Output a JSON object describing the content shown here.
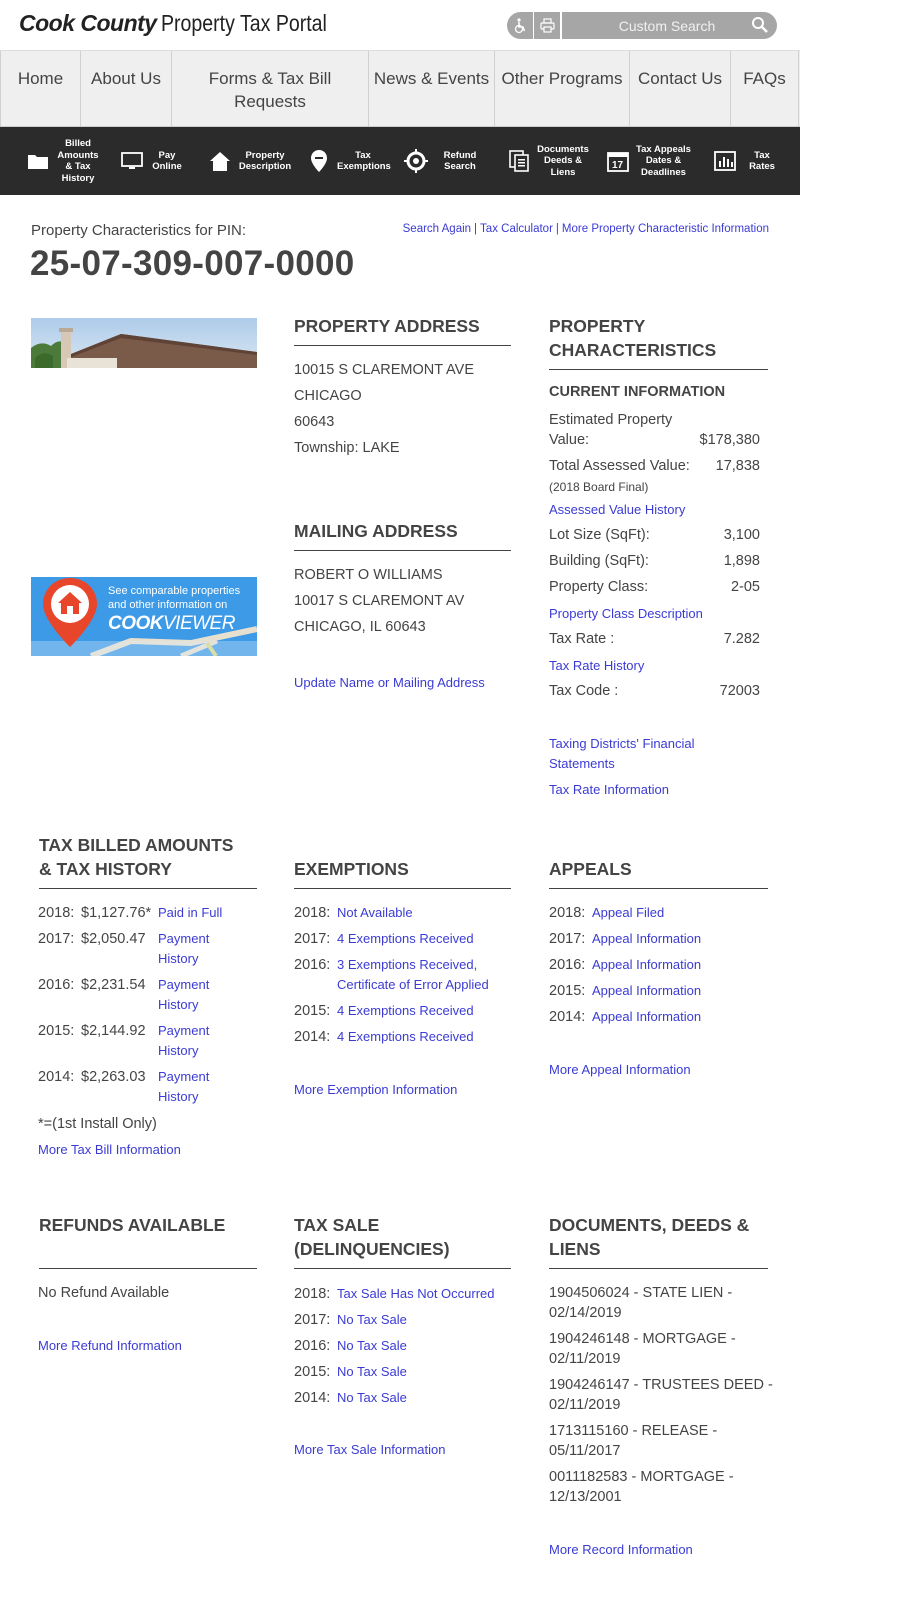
{
  "header": {
    "logo_bold": "Cook County",
    "logo_light": "Property Tax Portal",
    "search_placeholder": "Custom Search"
  },
  "main_nav": [
    "Home",
    "About Us",
    "Forms & Tax Bill Requests",
    "News & Events",
    "Other Programs",
    "Contact Us",
    "FAQs"
  ],
  "icon_bar": [
    {
      "icon": "folder-icon",
      "label": "Billed Amounts & Tax History"
    },
    {
      "icon": "monitor-icon",
      "label": "Pay Online"
    },
    {
      "icon": "house-icon",
      "label": "Property Description"
    },
    {
      "icon": "map-pin-icon",
      "label": "Tax Exemptions"
    },
    {
      "icon": "crosshair-icon",
      "label": "Refund Search"
    },
    {
      "icon": "documents-icon",
      "label": "Documents Deeds & Liens"
    },
    {
      "icon": "calendar-icon",
      "label": "Tax Appeals Dates & Deadlines"
    },
    {
      "icon": "bar-chart-icon",
      "label": "Tax Rates"
    }
  ],
  "pin": {
    "label": "Property Characteristics for PIN:",
    "number": "25-07-309-007-0000",
    "links": [
      "Search Again",
      "Tax Calculator",
      "More Property Characteristic Information"
    ]
  },
  "cookviewer": {
    "text_line1": "See comparable properties",
    "text_line2": "and other information on",
    "logo_a": "COOK",
    "logo_b": "VIEWER"
  },
  "property_address": {
    "title": "PROPERTY ADDRESS",
    "street": "10015 S CLAREMONT AVE",
    "city": "CHICAGO",
    "zip": "60643",
    "township": "Township: LAKE"
  },
  "mailing_address": {
    "title": "MAILING ADDRESS",
    "name": "ROBERT O WILLIAMS",
    "street": "10017 S CLAREMONT AV",
    "city": "CHICAGO, IL 60643",
    "update_link": "Update Name or Mailing Address"
  },
  "characteristics": {
    "title_line1": "PROPERTY",
    "title_line2": "CHARACTERISTICS",
    "current": "CURRENT INFORMATION",
    "est_label_1": "Estimated Property",
    "est_label_2": "Value:",
    "est_value": "$178,380",
    "tav_label": "Total Assessed Value:",
    "tav_value": "17,838",
    "tav_note": "(2018 Board Final)",
    "av_history": "Assessed Value History",
    "lot_label": "Lot Size (SqFt):",
    "lot_value": "3,100",
    "bldg_label": "Building (SqFt):",
    "bldg_value": "1,898",
    "class_label": "Property Class:",
    "class_value": "2-05",
    "class_link": "Property Class Description",
    "rate_label": "Tax Rate :",
    "rate_value": "7.282",
    "rate_link": "Tax Rate History",
    "code_label": "Tax Code :",
    "code_value": "72003",
    "districts_link_1": "Taxing Districts' Financial",
    "districts_link_2": "Statements",
    "rate_info_link": "Tax Rate Information"
  },
  "tax_billed": {
    "title_line1": "TAX BILLED AMOUNTS",
    "title_line2": "& TAX HISTORY",
    "rows": [
      {
        "year": "2018:",
        "amount": "$1,127.76*",
        "link": "Paid in Full"
      },
      {
        "year": "2017:",
        "amount": "$2,050.47",
        "link": "Payment History"
      },
      {
        "year": "2016:",
        "amount": "$2,231.54",
        "link": "Payment History"
      },
      {
        "year": "2015:",
        "amount": "$2,144.92",
        "link": "Payment History"
      },
      {
        "year": "2014:",
        "amount": "$2,263.03",
        "link": "Payment History"
      }
    ],
    "note": "*=(1st Install Only)",
    "more": "More Tax Bill Information"
  },
  "exemptions": {
    "title": "EXEMPTIONS",
    "rows": [
      {
        "year": "2018:",
        "link": "Not Available"
      },
      {
        "year": "2017:",
        "link": "4 Exemptions Received"
      },
      {
        "year": "2016:",
        "link": "3 Exemptions Received, Certificate of Error Applied"
      },
      {
        "year": "2015:",
        "link": "4 Exemptions Received"
      },
      {
        "year": "2014:",
        "link": "4 Exemptions Received"
      }
    ],
    "more": "More Exemption Information"
  },
  "appeals": {
    "title": "APPEALS",
    "rows": [
      {
        "year": "2018:",
        "link": "Appeal Filed"
      },
      {
        "year": "2017:",
        "link": "Appeal Information"
      },
      {
        "year": "2016:",
        "link": "Appeal Information"
      },
      {
        "year": "2015:",
        "link": "Appeal Information"
      },
      {
        "year": "2014:",
        "link": "Appeal Information"
      }
    ],
    "more": "More Appeal Information"
  },
  "refunds": {
    "title": "REFUNDS AVAILABLE",
    "status": "No Refund Available",
    "more": "More Refund Information"
  },
  "tax_sale": {
    "title_line1": "TAX SALE",
    "title_line2": "(DELINQUENCIES)",
    "rows": [
      {
        "year": "2018:",
        "link": "Tax Sale Has Not Occurred"
      },
      {
        "year": "2017:",
        "link": "No Tax Sale"
      },
      {
        "year": "2016:",
        "link": "No Tax Sale"
      },
      {
        "year": "2015:",
        "link": "No Tax Sale"
      },
      {
        "year": "2014:",
        "link": "No Tax Sale"
      }
    ],
    "more": "More Tax Sale Information"
  },
  "documents": {
    "title_line1": "DOCUMENTS, DEEDS &",
    "title_line2": "LIENS",
    "rows": [
      {
        "line1": "1904506024 - STATE LIEN -",
        "line2": "02/14/2019"
      },
      {
        "line1": "1904246148 - MORTGAGE -",
        "line2": "02/11/2019"
      },
      {
        "line1": "1904246147 - TRUSTEES DEED -",
        "line2": "02/11/2019"
      },
      {
        "line1": "1713115160 - RELEASE -",
        "line2": "05/11/2017"
      },
      {
        "line1": "0011182583 - MORTGAGE -",
        "line2": "12/13/2001"
      }
    ],
    "more": "More Record Information"
  }
}
